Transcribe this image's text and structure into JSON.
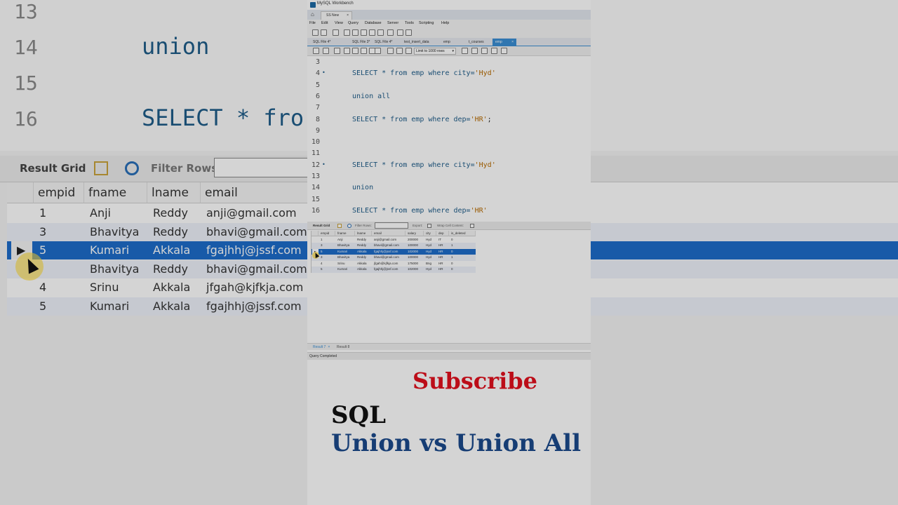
{
  "window": {
    "app_title": "MySQL Workbench",
    "connection_tab": "SS New",
    "close_glyph": "×",
    "home_icon": "home-icon"
  },
  "menu": [
    "File",
    "Edit",
    "View",
    "Query",
    "Database",
    "Server",
    "Tools",
    "Scripting",
    "Help"
  ],
  "tabs": [
    {
      "label": "SQL File 4*",
      "active": false
    },
    {
      "label": "SQL File 3*",
      "active": false
    },
    {
      "label": "SQL File 4*",
      "active": false
    },
    {
      "label": "test_insert_data",
      "active": false
    },
    {
      "label": "emp",
      "active": false
    },
    {
      "label": "t_courses",
      "active": false
    },
    {
      "label": "emp",
      "active": true
    }
  ],
  "toolbar": {
    "limit_label": "Limit to 1000 rows",
    "limit_arrow": "▾"
  },
  "editor": {
    "lines": [
      {
        "num": "3",
        "code": ""
      },
      {
        "num": "4",
        "code": "SELECT * from emp where city='Hyd'",
        "dot": "•"
      },
      {
        "num": "5",
        "code": ""
      },
      {
        "num": "6",
        "code": "union all"
      },
      {
        "num": "7",
        "code": ""
      },
      {
        "num": "8",
        "code": "SELECT * from emp where dep='HR';"
      },
      {
        "num": "9",
        "code": ""
      },
      {
        "num": "10",
        "code": ""
      },
      {
        "num": "11",
        "code": ""
      },
      {
        "num": "12",
        "code": "SELECT * from emp where city='Hyd'",
        "dot": "•"
      },
      {
        "num": "13",
        "code": ""
      },
      {
        "num": "14",
        "code": "union"
      },
      {
        "num": "15",
        "code": ""
      },
      {
        "num": "16",
        "code": "SELECT * from emp where dep='HR'"
      }
    ]
  },
  "results_toolbar": {
    "result_grid": "Result Grid",
    "filter_rows": "Filter Rows:",
    "export": "Export:",
    "wrap": "Wrap Cell Content:"
  },
  "grid": {
    "columns": [
      "empid",
      "fname",
      "lname",
      "email",
      "salary",
      "city",
      "dep",
      "is_deleted"
    ],
    "rows": [
      [
        "1",
        "Anji",
        "Reddy",
        "anji@gmail.com",
        "200000",
        "Hyd",
        "IT",
        "0"
      ],
      [
        "3",
        "Bhavitya",
        "Reddy",
        "bhavi@gmail.com",
        "100000",
        "Hyd",
        "HR",
        "1"
      ],
      [
        "5",
        "Kumari",
        "Akkala",
        "fgajhhj@jssf.com",
        "102000",
        "Hyd",
        "HR",
        "0"
      ],
      [
        "3",
        "Bhavitya",
        "Reddy",
        "bhavi@gmail.com",
        "100000",
        "Hyd",
        "HR",
        "1"
      ],
      [
        "4",
        "Srinu",
        "Akkala",
        "jfgah@kjfkja.com",
        "175000",
        "Bng",
        "HR",
        "0"
      ],
      [
        "5",
        "Kumari",
        "Akkala",
        "fgajhhj@jssf.com",
        "102000",
        "Hyd",
        "HR",
        "0"
      ]
    ],
    "selected_row": 2
  },
  "result_tabs": [
    {
      "label": "Result 7",
      "close": "×",
      "active": true
    },
    {
      "label": "Result 8",
      "active": false
    }
  ],
  "status": "Query Completed",
  "overlay": {
    "subscribe": "Subscribe",
    "sql": "SQL",
    "topic": "Union vs Union All"
  },
  "background": {
    "lines": [
      {
        "num": "13",
        "code": ""
      },
      {
        "num": "14",
        "code": "union"
      },
      {
        "num": "15",
        "code": ""
      },
      {
        "num": "16",
        "code": "SELECT * fro"
      }
    ],
    "result_grid": "Result Grid",
    "filter_rows": "Filter Rows:",
    "columns": [
      "empid",
      "fname",
      "lname",
      "email"
    ],
    "rows": [
      [
        "1",
        "Anji",
        "Reddy",
        "anji@gmail.com"
      ],
      [
        "3",
        "Bhavitya",
        "Reddy",
        "bhavi@gmail.com"
      ],
      [
        "5",
        "Kumari",
        "Akkala",
        "fgajhhj@jssf.com"
      ],
      [
        "",
        "Bhavitya",
        "Reddy",
        "bhavi@gmail.com"
      ],
      [
        "4",
        "Srinu",
        "Akkala",
        "jfgah@kjfkja.com"
      ],
      [
        "5",
        "Kumari",
        "Akkala",
        "fgajhhj@jssf.com"
      ]
    ],
    "selected_row": 2
  },
  "colors": {
    "accent": "#3a8fd4",
    "selection": "#1d6dca",
    "keyword": "#1f5d8a",
    "string": "#b86b00",
    "subscribe": "#e3101e",
    "topic": "#1b4a8c"
  }
}
